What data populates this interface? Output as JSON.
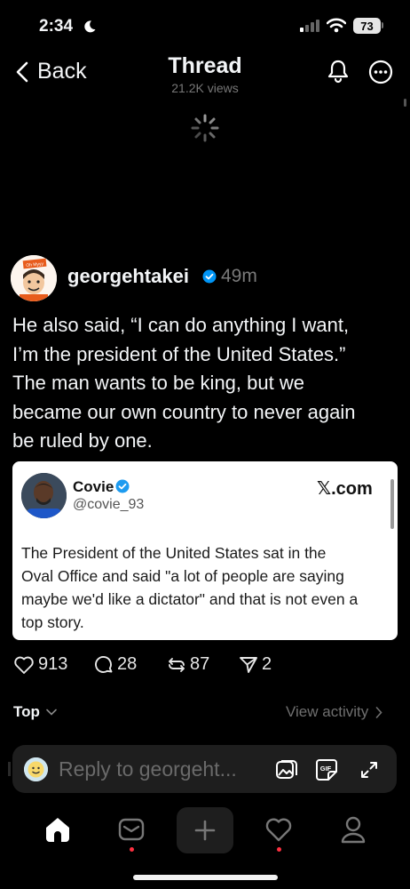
{
  "status_bar": {
    "time": "2:34",
    "battery": "73"
  },
  "header": {
    "back_label": "Back",
    "title": "Thread",
    "views": "21.2K views"
  },
  "post": {
    "username": "georgehtakei",
    "time": "49m",
    "text_lines": [
      "He also said, “I can do anything I want,",
      "I’m the president of the United States.”",
      "The man wants to be king, but we",
      "became our own country to never again",
      "be ruled by one."
    ],
    "avatar_sign_text": "Oh Myyy"
  },
  "quote": {
    "name": "Covie",
    "handle": "@covie_93",
    "source": "𝕏.com",
    "text_lines": [
      "The President of the United States sat in the",
      "Oval Office and said \"a lot of people are saying",
      "maybe we'd like a dictator\" and that is not even a",
      "top story."
    ]
  },
  "actions": {
    "likes": "913",
    "replies": "28",
    "reposts": "87",
    "shares": "2"
  },
  "sort": {
    "label": "Top",
    "activity_label": "View activity"
  },
  "reply": {
    "placeholder": "Reply to georgeht...",
    "gif_label": "GIF"
  },
  "icons": {
    "back": "chevron-left-icon",
    "bell": "bell-icon",
    "more": "more-icon",
    "like": "heart-icon",
    "reply": "comment-icon",
    "repost": "repost-icon",
    "share": "send-icon",
    "home": "home-icon",
    "inbox": "inbox-icon",
    "compose": "plus-icon",
    "activity": "heart-icon",
    "profile": "person-icon"
  },
  "colors": {
    "background": "#000000",
    "verified": "#0095f6",
    "notification_dot": "#ff3040",
    "card": "#ffffff"
  }
}
